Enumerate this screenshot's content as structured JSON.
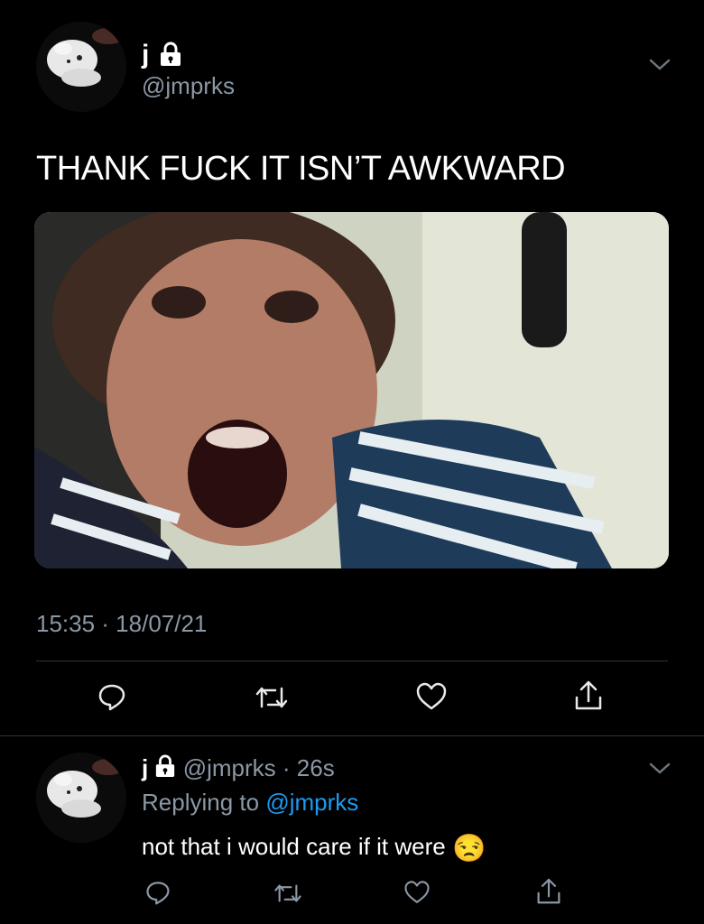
{
  "main_tweet": {
    "display_name": "j",
    "handle": "@jmprks",
    "text": "THANK FUCK IT ISN’T AWKWARD",
    "image_alt": "crying child screaming",
    "timestamp": "15:35 · 18/07/21",
    "actions": [
      "reply-icon",
      "retweet-icon",
      "like-icon",
      "share-icon"
    ]
  },
  "reply_tweet": {
    "display_name": "j",
    "handle": "@jmprks",
    "time": "· 26s",
    "replying_prefix": "Replying to",
    "replying_to": "@jmprks",
    "text": "not that i would care if it were",
    "emoji": "😒",
    "actions": [
      "reply-icon",
      "retweet-icon",
      "like-icon",
      "share-icon"
    ]
  },
  "colors": {
    "background": "#000000",
    "text": "#ffffff",
    "muted": "#8b98a5",
    "link": "#1d9bf0",
    "divider": "#2f3336"
  }
}
